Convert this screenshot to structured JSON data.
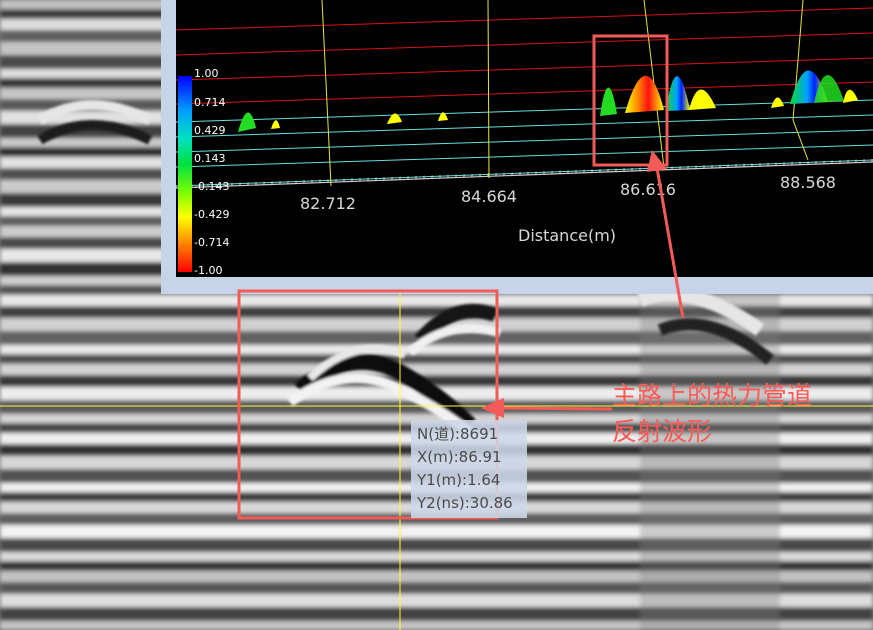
{
  "colors": {
    "annotation": "#f25b57",
    "plot_background": "#000000",
    "crosshair": "#ffff33",
    "grid_red": "#e01010",
    "grid_cyan": "#66e0e0",
    "viewer_border": "#c7d3e6",
    "readout_background": "#cdd7e8"
  },
  "colorbar": {
    "labels": [
      "1.00",
      "0.714",
      "0.429",
      "0.143",
      "-0.143",
      "-0.429",
      "-0.714",
      "-1.00"
    ],
    "gradient": [
      "#0000ff",
      "#00a0ff",
      "#00e0c0",
      "#00e040",
      "#80ff00",
      "#ffff00",
      "#ff8000",
      "#ff0000"
    ]
  },
  "distance_axis": {
    "title": "Distance(m)",
    "ticks": [
      "82.712",
      "84.664",
      "86.616",
      "88.568"
    ]
  },
  "readout": {
    "n": "N(道):8691",
    "x": "X(m):86.91",
    "y1": "Y1(m):1.64",
    "y2": "Y2(ns):30.86"
  },
  "annotation": {
    "line1": "主路上的热力管道",
    "line2": "反射波形"
  }
}
